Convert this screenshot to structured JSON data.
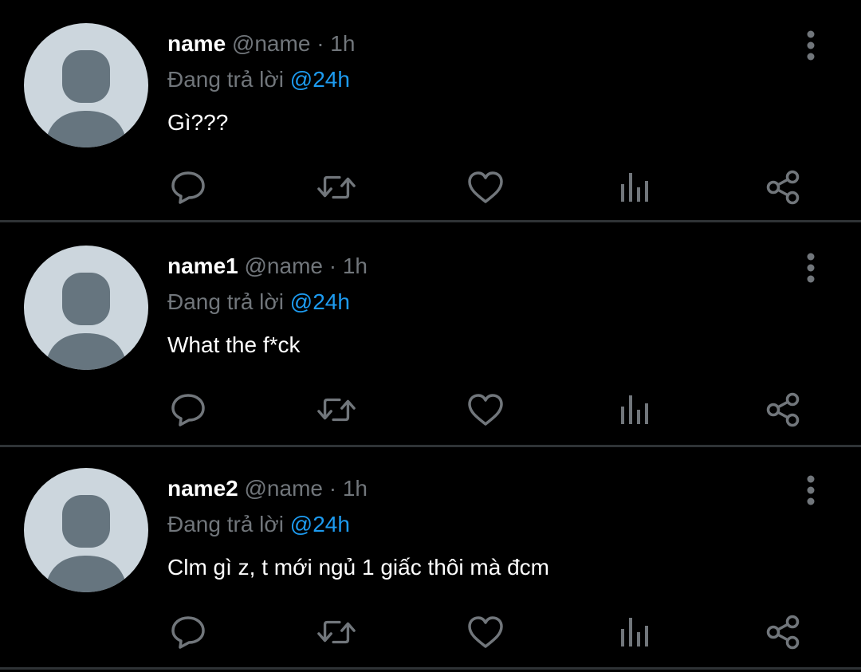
{
  "colors": {
    "background": "#000000",
    "divider": "#2f3336",
    "secondary_text": "#71767b",
    "mention": "#1d9bf0",
    "avatar_bg": "#ccd6dd",
    "avatar_fg": "#66757f"
  },
  "icons": {
    "reply": "speech-bubble-icon",
    "retweet": "retweet-arrows-icon",
    "like": "heart-icon",
    "views": "bar-chart-icon",
    "share": "share-nodes-icon",
    "more": "vertical-ellipsis-icon",
    "avatar": "default-profile-icon"
  },
  "tweets": [
    {
      "display_name": "name",
      "handle": "@name",
      "separator": "·",
      "time": "1h",
      "replying_prefix": "Đang trả lời",
      "replying_to": "@24h",
      "text": "Gì???"
    },
    {
      "display_name": "name1",
      "handle": "@name",
      "separator": "·",
      "time": "1h",
      "replying_prefix": "Đang trả lời",
      "replying_to": "@24h",
      "text": "What the f*ck"
    },
    {
      "display_name": "name2",
      "handle": "@name",
      "separator": "·",
      "time": "1h",
      "replying_prefix": "Đang trả lời",
      "replying_to": "@24h",
      "text": "Clm gì z, t mới ngủ 1 giấc thôi mà đcm"
    }
  ]
}
